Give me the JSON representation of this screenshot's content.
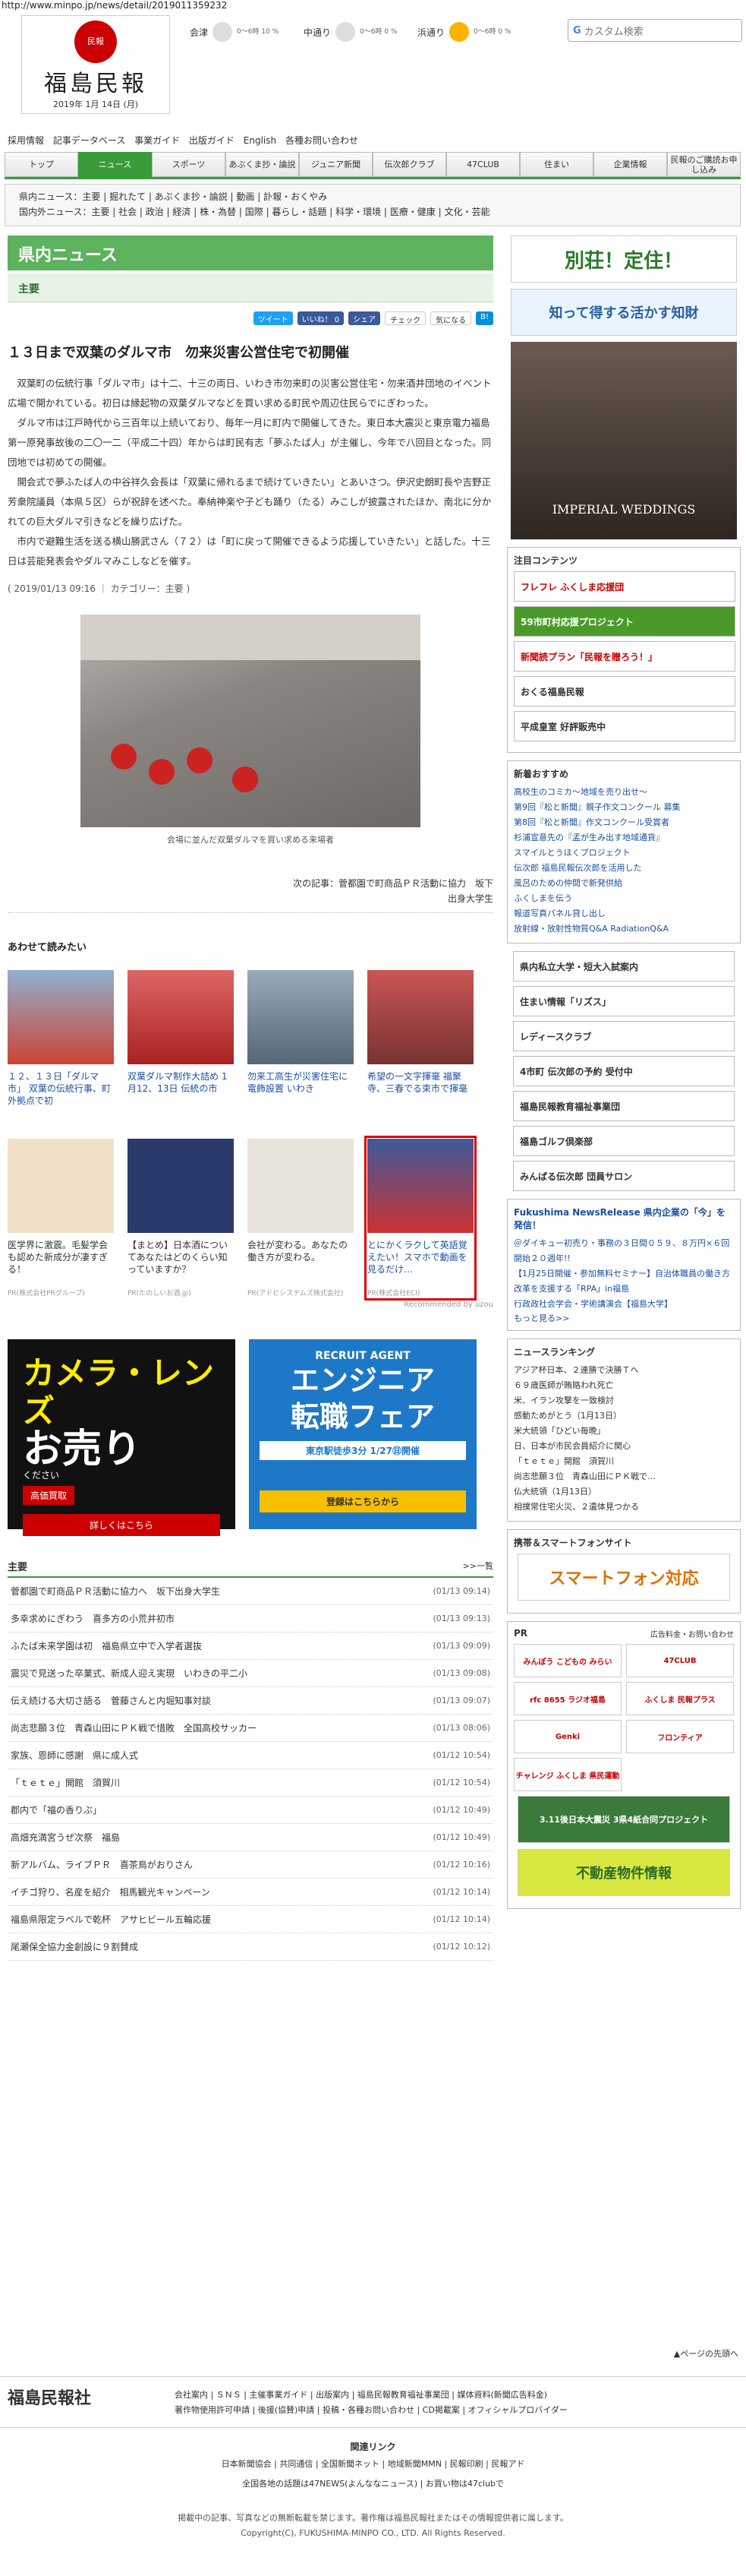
{
  "url": "http://www.minpo.jp/news/detail/2019011359232",
  "logo": {
    "mark": "民報",
    "name": "福島民報",
    "date": "2019年 1月 14日 (月)"
  },
  "weather": [
    {
      "area": "会津",
      "pop": "0〜6時 10 %"
    },
    {
      "area": "中通り",
      "pop": "0〜6時 0 %"
    },
    {
      "area": "浜通り",
      "pop": "0〜6時 0 %"
    }
  ],
  "search_placeholder": "カスタム検索",
  "toplinks": [
    "採用情報",
    "記事データベース",
    "事業ガイド",
    "出版ガイド",
    "English",
    "各種お問い合わせ"
  ],
  "gnav": [
    "トップ",
    "ニュース",
    "スポーツ",
    "あぶくま抄・論説",
    "ジュニア新聞",
    "伝次郎クラブ",
    "47CLUB",
    "住まい",
    "企業情報",
    "民報のご購読お申し込み"
  ],
  "subnav": {
    "l1": "県内ニュース：主要 | 掘れたて | あぶくま抄・論説 | 動画 | 訃報・おくやみ",
    "l2": "国内外ニュース：主要 | 社会 | 政治 | 経済 | 株・為替 | 国際 | 暮らし・話題 | 科学・環境 | 医療・健康 | 文化・芸能"
  },
  "section": "県内ニュース",
  "subsection": "主要",
  "social": [
    "ツイート",
    "いいね！ 0",
    "シェア",
    "チェック",
    "気になる",
    "B!"
  ],
  "headline": "１３日まで双葉のダルマ市　勿来災害公営住宅で初開催",
  "body": [
    "双葉町の伝統行事「ダルマ市」は十二、十三の両日、いわき市勿来町の災害公営住宅・勿来酒井団地のイベント広場で開かれている。初日は縁起物の双葉ダルマなどを買い求める町民や周辺住民らでにぎわった。",
    "ダルマ市は江戸時代から三百年以上続いており、毎年一月に町内で開催してきた。東日本大震災と東京電力福島第一原発事故後の二〇一二（平成二十四）年からは町民有志「夢ふたば人」が主催し、今年で八回目となった。同団地では初めての開催。",
    "開会式で夢ふたば人の中谷祥久会長は「双葉に帰れるまで続けていきたい」とあいさつ。伊沢史朗町長や吉野正芳衆院議員（本県５区）らが祝辞を述べた。奉納神楽や子ども踊り（たる）みこしが披露されたほか、南北に分かれての巨大ダルマ引きなどを繰り広げた。",
    "市内で避難生活を送る横山勝武さん（７２）は「町に戻って開催できるよう応援していきたい」と話した。十三日は芸能発表会やダルマみこしなどを催す。"
  ],
  "meta": "( 2019/01/13 09:16 ｜ カテゴリー：主要 )",
  "caption": "会場に並んだ双葉ダルマを買い求める来場者",
  "next": {
    "l1": "次の記事：菅都園で町商品ＰＲ活動に協力　坂下",
    "l2": "出身大学生"
  },
  "also_title": "あわせて読みたい",
  "cards": [
    {
      "t": "１２、１３日「ダルマ市」 双葉の伝統行事、町外拠点で初",
      "p": ""
    },
    {
      "t": "双葉ダルマ制作大詰め 1月12、13日 伝統の市",
      "p": ""
    },
    {
      "t": "勿来工高生が災害住宅に電飾設置 いわき",
      "p": ""
    },
    {
      "t": "希望の一文字揮毫 福聚寺、三春でる束市で揮毫",
      "p": ""
    },
    {
      "t": "医学界に激震。毛髪学会も認めた新成分が凄すぎる！",
      "p": "PR(株式会社PRグループ)"
    },
    {
      "t": "【まとめ】日本酒についてあなたはどのくらい知っていますか？",
      "p": "PR(たのしいお酒.jp)"
    },
    {
      "t": "会社が変わる。あなたの働き方が変わる。",
      "p": "PR(アドビシステムズ株式会社)"
    },
    {
      "t": "とにかくラクして英語覚えたい！スマホで動画を見るだけ…",
      "p": "PR(株式会社ECI)"
    }
  ],
  "recommended": "Recommended by uzou",
  "ad_cam": {
    "l1": "カメラ・レンズ",
    "l2": "お売り",
    "l3": "ください",
    "l4": "高価買取",
    "l5": "詳しくはこちら"
  },
  "ad_eng": {
    "l1": "RECRUIT AGENT",
    "l2": "エンジニア",
    "l3": "転職フェア",
    "l4": "東京駅徒歩3分 1/27㊐開催",
    "l5": "登録はこちらから"
  },
  "list_title": "主要",
  "list_more": ">>一覧",
  "list": [
    {
      "t": "菅都園で町商品ＰＲ活動に協力へ　坂下出身大学生",
      "d": "(01/13 09:14)"
    },
    {
      "t": "多幸求めにぎわう　喜多方の小荒井初市",
      "d": "(01/13 09:13)"
    },
    {
      "t": "ふたば未来学園は初　福島県立中で入学者選抜",
      "d": "(01/13 09:09)"
    },
    {
      "t": "震災で見送った卒業式、新成人迎え実現　いわきの平二小",
      "d": "(01/13 09:08)"
    },
    {
      "t": "伝え続ける大切さ語る　菅藤さんと内堀知事対談",
      "d": "(01/13 09:07)"
    },
    {
      "t": "尚志悲願３位　青森山田にＰＫ戦で惜敗　全国高校サッカー",
      "d": "(01/13 08:06)"
    },
    {
      "t": "家族、恩師に感謝　県に成人式",
      "d": "(01/12 10:54)"
    },
    {
      "t": "「ｔｅｔｅ」開館　須賀川",
      "d": "(01/12 10:54)"
    },
    {
      "t": "郡内で「福の香りぶ」",
      "d": "(01/12 10:49)"
    },
    {
      "t": "高畑充満宮うぜ次祭　福島",
      "d": "(01/12 10:49)"
    },
    {
      "t": "新アルバム、ライブＰＲ　喜茶鳥がおりさん",
      "d": "(01/12 10:16)"
    },
    {
      "t": "イチゴ狩り、名産を紹介　相馬観光キャンペーン",
      "d": "(01/12 10:14)"
    },
    {
      "t": "福島県限定ラベルで乾杯　アサヒビール五輪応援",
      "d": "(01/12 10:14)"
    },
    {
      "t": "尾瀬保全協力金創設に９割賛成",
      "d": "(01/12 10:12)"
    }
  ],
  "side": {
    "b1": "別荘！定住！",
    "b2": "知って得する活かす知財",
    "wed": "IMPERIAL WEDDINGS",
    "focus": "注目コンテンツ",
    "btns": [
      "フレフレ ふくしま応援団",
      "59市町村応援プロジェクト",
      "新聞読プラン「民報を贈ろう！」",
      "おくる福島民報",
      "平成皇室 好評販売中"
    ],
    "rec_title": "新着おすすめ",
    "rec": [
      "高校生のコミカ〜地域を売り出せ〜",
      "第9回『松と新聞』親子作文コンクール 募集",
      "第8回『松と新聞』作文コンクール受賞者",
      "杉浦宣意先の『孟が生み出す地域通貨』",
      "スマイルとうほくプロジェクト",
      "伝次郎 福島民報伝次郎を活用した",
      "風呂のための仲間で新発供給",
      "ふくしまを伝う",
      "報道写真パネル貸し出し",
      "放射線・放射性物質Q&A RadiationQ&A"
    ],
    "side_btns": [
      "県内私立大学・短大入試案内",
      "住まい情報「リズス」",
      "レディースクラブ",
      "4市町 伝次郎の予約 受付中",
      "福島民報教育福祉事業団",
      "福島ゴルフ倶楽部",
      "みんぱる伝次郎 団員サロン"
    ],
    "fuku_title": "Fukushima NewsRelease 県内企業の「今」を発信！",
    "fuku": [
      "＠ダイキュー初売り・事務の３日間０５９、８万円×６回開始２０週年!!",
      "【1月25日開催・参加無料セミナー】自治体職員の働き方改革を支援する「RPA」in福島",
      "行政政社会学会・学術講演会【福島大学】"
    ],
    "fuku_more": "もっと見る>>",
    "rank_title": "ニュースランキング",
    "rank": [
      "アジア杯日本、２連勝で決勝Ｔへ",
      "６９歳医師が賄賂われ死亡",
      "米、イラン攻撃を一致検討",
      "感動ためがとう（1月13日）",
      "米大統領「ひどい毎晩」",
      "日、日本が市民会員紹介に関心",
      "「ｔｅｔｅ」開館　須賀川",
      "尚志悲願３位　青森山田にＰＫ戦で…",
      "仏大統領（1月13日）",
      "相撲常住宅火災、２遺体見つかる"
    ],
    "mobile_title": "携帯＆スマートフォンサイト",
    "mobile": "スマートフォン対応",
    "pr_title": "PR",
    "pr_more": "広告料金・お問い合わせ",
    "pr": [
      "みんぽう こどもの みらい",
      "47CLUB",
      "rfc 8655 ラジオ福島",
      "ふくしま 民報プラス",
      "Genki",
      "フロンティア",
      "チャレンジ ふくしま 県民運動",
      "3.11後日本大震災 3県4紙合同プロジェクト",
      "不動産物件情報"
    ]
  },
  "footer": {
    "top": "▲ページの先頭へ",
    "logo": "福島民報社",
    "l1": "会社案内 | ＳＮＳ | 主催事業ガイド | 出版案内 | 福島民報教育福祉事業団 | 媒体資料(新聞広告料金)",
    "l2": "著作物使用許可申請 | 後援(協賛)申請 | 投稿・各種お問い合わせ | CD掲載案 | オフィシャルプロバイダー",
    "rel": "関連リンク",
    "r1": "日本新聞協会 | 共同通信 | 全国新聞ネット | 地域新聞MMN | 民報印刷 | 民報アド",
    "r2": "全国各地の話題は47NEWS(よんななニュース) | お買い物は47clubで",
    "c1": "掲載中の記事、写真などの無断転載を禁じます。著作権は福島民報社またはその情報提供者に属します。",
    "c2": "Copyright(C), FUKUSHIMA-MINPO CO., LTD. All Rights Reserved."
  }
}
